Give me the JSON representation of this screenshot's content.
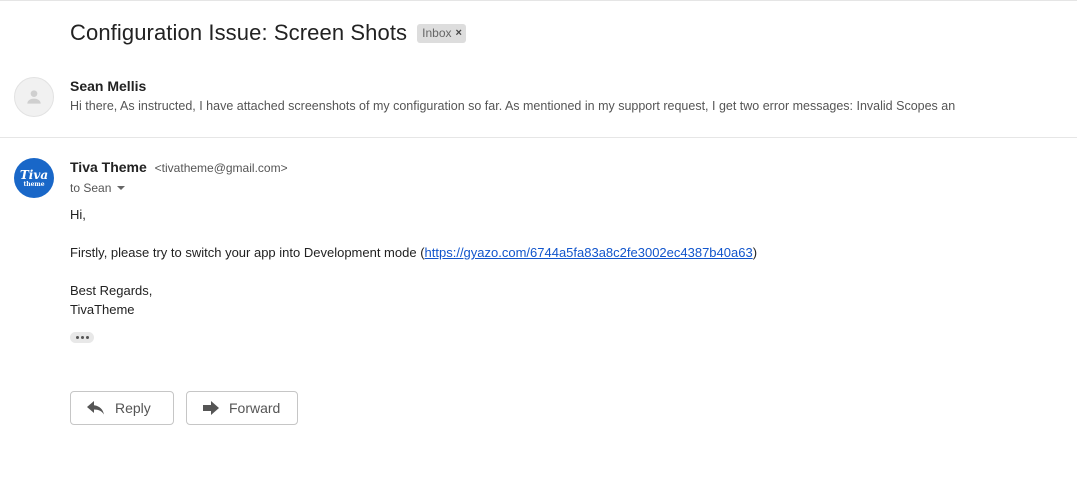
{
  "thread": {
    "subject": "Configuration Issue: Screen Shots",
    "label": "Inbox",
    "label_remove": "×"
  },
  "collapsed_message": {
    "sender": "Sean Mellis",
    "snippet": "Hi there, As instructed, I have attached screenshots of my configuration so far. As mentioned in my support request, I get two error messages: Invalid Scopes an",
    "avatar_icon": "person-icon"
  },
  "expanded_message": {
    "sender_name": "Tiva Theme",
    "sender_email": "<tivatheme@gmail.com>",
    "recipient_line": "to Sean",
    "avatar_logo_main": "Tiva",
    "avatar_logo_sub": "theme",
    "body": {
      "greeting": "Hi,",
      "line1_prefix": "Firstly, please try to switch your app into Development mode (",
      "link": "https://gyazo.com/6744a5fa83a8c2fe3002ec4387b40a63",
      "line1_suffix": ")",
      "closing": "Best Regards,",
      "signature": "TivaTheme"
    }
  },
  "actions": {
    "reply_label": "Reply",
    "forward_label": "Forward"
  },
  "colors": {
    "link": "#1155cc",
    "avatar_blue": "#1967c8",
    "chip_bg": "#dddddd"
  }
}
